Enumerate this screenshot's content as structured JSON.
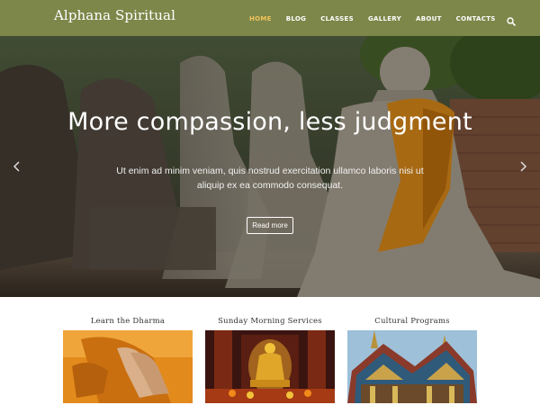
{
  "site": {
    "title": "Alphana Spiritual"
  },
  "nav": {
    "items": [
      {
        "label": "HOME",
        "active": true
      },
      {
        "label": "BLOG"
      },
      {
        "label": "CLASSES"
      },
      {
        "label": "GALLERY"
      },
      {
        "label": "ABOUT"
      },
      {
        "label": "CONTACTS"
      }
    ],
    "search_icon": "search-icon"
  },
  "hero": {
    "title": "More compassion, less judgment",
    "text": "Ut enim ad minim veniam, quis nostrud exercitation ullamco laboris nisi ut aliquip ex ea commodo consequat.",
    "button_label": "Read more",
    "prev_icon": "chevron-left-icon",
    "next_icon": "chevron-right-icon"
  },
  "services": [
    {
      "title": "Learn the Dharma",
      "image": "praying-hands-image"
    },
    {
      "title": "Sunday Morning Services",
      "image": "golden-buddha-shrine-image"
    },
    {
      "title": "Cultural Programs",
      "image": "thai-temple-roof-image"
    }
  ],
  "colors": {
    "header_bg": "#7d874a",
    "nav_active": "#f2c35a",
    "robe_orange": "#e8921a"
  }
}
